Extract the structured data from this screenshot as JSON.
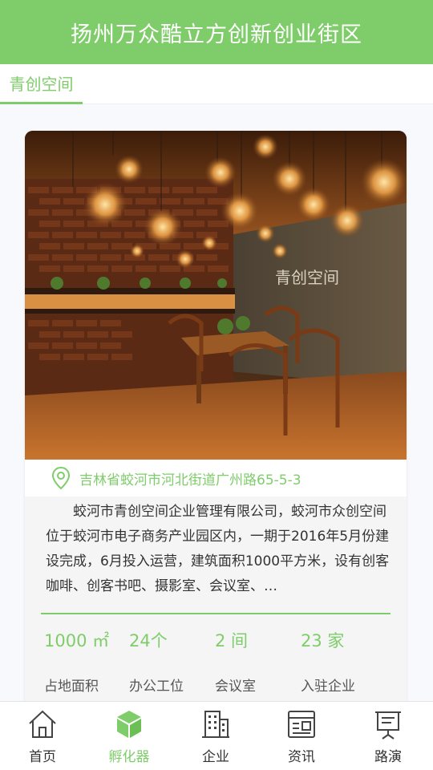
{
  "header": {
    "title": "扬州万众酷立方创新创业街区"
  },
  "tabs": [
    {
      "label": "青创空间",
      "active": true
    }
  ],
  "card": {
    "photo_sign": "青创空间",
    "address": "吉林省蛟河市河北街道广州路65-5-3",
    "description": "蛟河市青创空间企业管理有限公司，蛟河市众创空间位于蛟河市电子商务产业园区内，一期于2016年5月份建设完成，6月投入运营，建筑面积1000平方米，设有创客咖啡、创客书吧、摄影室、会议室、…",
    "stats": [
      {
        "value": "1000 ㎡",
        "label": "占地面积"
      },
      {
        "value": "24个",
        "label": "办公工位"
      },
      {
        "value": "2 间",
        "label": "会议室"
      },
      {
        "value": "23 家",
        "label": "入驻企业"
      }
    ]
  },
  "nav": [
    {
      "label": "首页",
      "icon": "home-icon",
      "active": false
    },
    {
      "label": "孵化器",
      "icon": "cube-icon",
      "active": true
    },
    {
      "label": "企业",
      "icon": "building-icon",
      "active": false
    },
    {
      "label": "资讯",
      "icon": "news-icon",
      "active": false
    },
    {
      "label": "路演",
      "icon": "presentation-icon",
      "active": false
    }
  ],
  "colors": {
    "accent": "#7fcd6a",
    "text": "#333333",
    "background": "#f7f9fc"
  }
}
